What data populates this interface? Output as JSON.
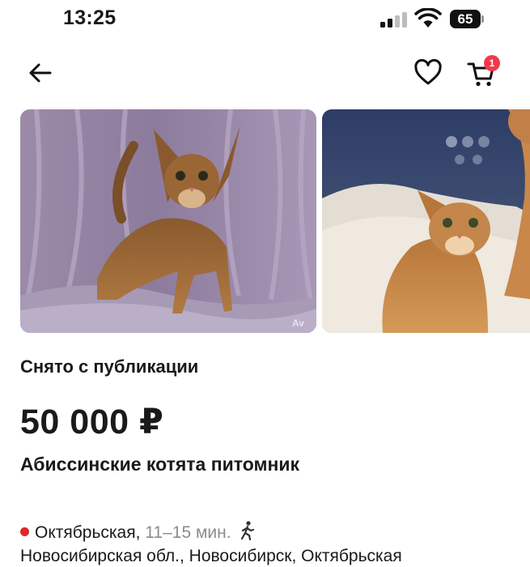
{
  "status_bar": {
    "time": "13:25",
    "battery": "65",
    "icons": [
      "cellular-signal-icon",
      "wifi-icon",
      "battery-icon"
    ]
  },
  "nav": {
    "icons": [
      "back-arrow-icon",
      "heart-icon",
      "cart-icon"
    ],
    "cart_count": "1"
  },
  "gallery": {
    "watermark": "Av",
    "colors": {
      "accent_badge": "#f2394a",
      "metro_line": "#e0262e"
    }
  },
  "listing": {
    "status": "Снято с публикации",
    "price": "50 000 ₽",
    "title": "Абиссинские котята питомник",
    "metro_station": "Октябрьская,",
    "metro_time": "11–15 мин.",
    "address": "Новосибирская обл., Новосибирск, Октябрьская"
  }
}
